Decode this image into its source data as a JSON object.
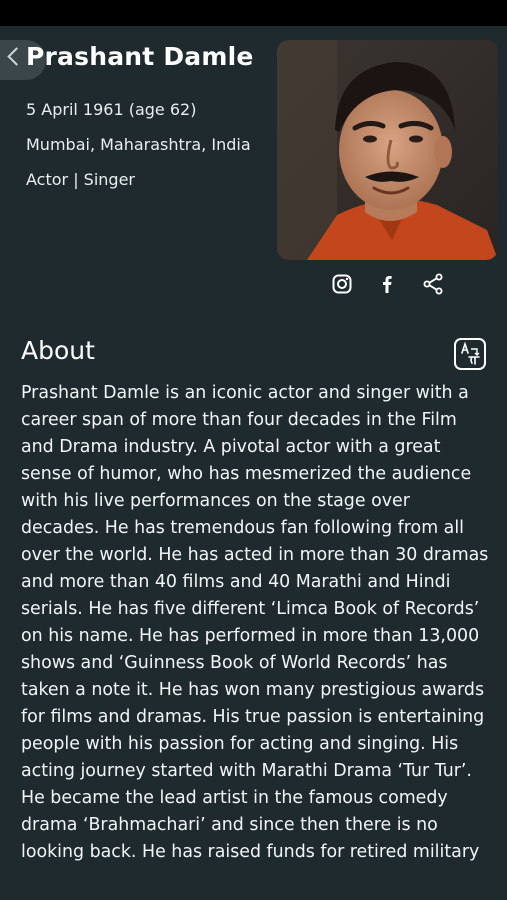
{
  "profile": {
    "name": "Prashant Damle",
    "birth": "5 April 1961 (age 62)",
    "place": "Mumbai, Maharashtra, India",
    "roles": "Actor | Singer"
  },
  "socials": {
    "icons": [
      "instagram-icon",
      "facebook-icon",
      "share-icon"
    ]
  },
  "about": {
    "title": "About",
    "text": "Prashant Damle is an iconic actor and singer with a career span of more than four decades in the Film and Drama industry. A pivotal actor with a great sense of humor, who has mesmerized the audience with his live performances on the stage over decades. He has tremendous fan following from all over the world. He has acted in more than 30 dramas and more than 40 films and 40 Marathi and Hindi serials. He has five different ‘Limca Book of Records’ on his name. He has performed in more than 13,000 shows and ‘Guinness Book of World Records’ has taken a note it. He has won many prestigious awards for films and dramas. His true passion is entertaining people with his passion for acting and singing. His acting journey started with Marathi Drama ‘Tur Tur’. He became the lead artist in the famous comedy drama ‘Brahmachari’ and since then there is no looking back. He has raised funds for retired military"
  },
  "colors": {
    "background": "#1f2a2e",
    "status_bar": "#000000",
    "back_tab": "#3a464a",
    "text": "#ffffff"
  }
}
